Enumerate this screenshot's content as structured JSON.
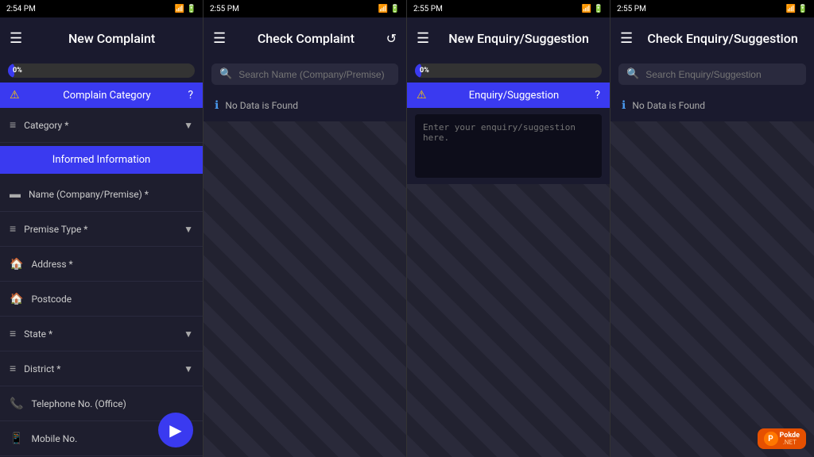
{
  "panels": {
    "panel1": {
      "title": "New Complaint",
      "status_bar": {
        "time": "2:54 PM",
        "icons": "battery wifi signal"
      },
      "progress": {
        "label": "0%",
        "value": 2
      },
      "complaint_category": {
        "section_label": "Complain Category",
        "alert_icon": "⚠",
        "help_icon": "?"
      },
      "form_rows": [
        {
          "icon": "≡",
          "label": "Category *",
          "has_chevron": true
        },
        {
          "icon": null,
          "label": "Informed Information",
          "is_button": true
        },
        {
          "icon": "▬",
          "label": "Name (Company/Premise) *",
          "has_chevron": false
        },
        {
          "icon": "≡",
          "label": "Premise Type *",
          "has_chevron": true
        },
        {
          "icon": "🏠",
          "label": "Address *",
          "has_chevron": false
        },
        {
          "icon": "🏠",
          "label": "Postcode",
          "has_chevron": false
        },
        {
          "icon": "≡",
          "label": "State *",
          "has_chevron": true
        },
        {
          "icon": "≡",
          "label": "District *",
          "has_chevron": true
        },
        {
          "icon": "📞",
          "label": "Telephone No. (Office)",
          "has_chevron": false
        },
        {
          "icon": null,
          "label": "Mobile No.",
          "has_chevron": false
        }
      ],
      "fab_icon": "▶"
    },
    "panel2": {
      "title": "Check Complaint",
      "status_bar": {
        "time": "2:55 PM"
      },
      "search_placeholder": "Search Name (Company/Premise)",
      "no_data_text": "No Data is Found",
      "refresh_icon": "↺"
    },
    "panel3": {
      "title": "New Enquiry/Suggestion",
      "status_bar": {
        "time": "2:55 PM"
      },
      "progress": {
        "label": "0%",
        "value": 2
      },
      "section": {
        "label": "Enquiry/Suggestion",
        "alert_icon": "⚠",
        "help_icon": "?"
      },
      "textarea_placeholder": "Enter your enquiry/suggestion here."
    },
    "panel4": {
      "title": "Check Enquiry/Suggestion",
      "status_bar": {
        "time": "2:55 PM"
      },
      "search_placeholder": "Search Enquiry/Suggestion",
      "no_data_text": "No Data is Found"
    }
  },
  "watermark": {
    "top": "Pokde",
    "bottom": ".NET"
  }
}
